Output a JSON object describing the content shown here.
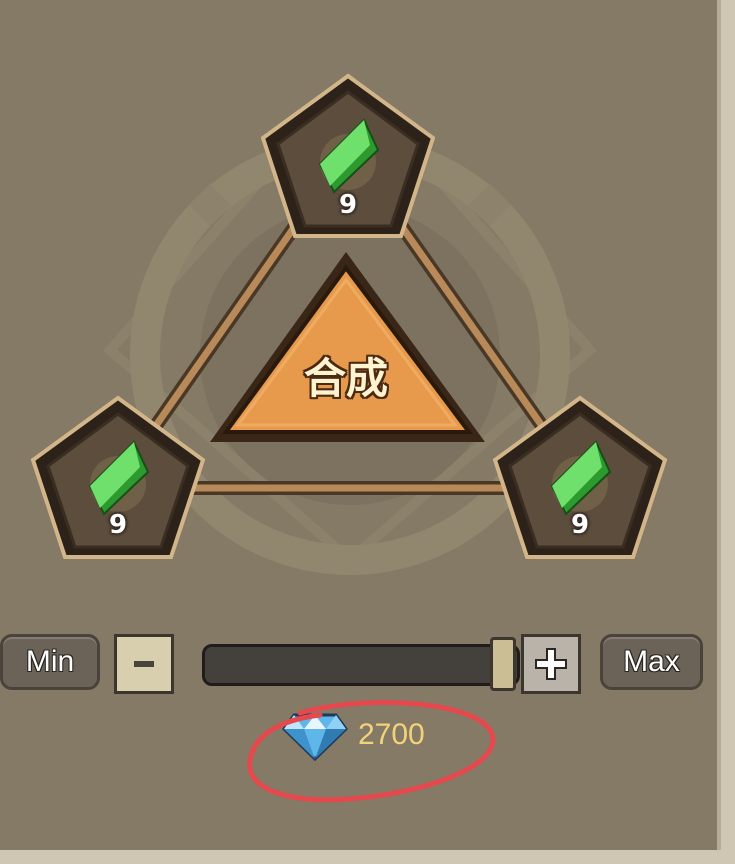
{
  "craft": {
    "button_label": "合成",
    "slots": [
      {
        "position": "top",
        "item_icon": "green-crystal-icon",
        "count": "9"
      },
      {
        "position": "left",
        "item_icon": "green-crystal-icon",
        "count": "9"
      },
      {
        "position": "right",
        "item_icon": "green-crystal-icon",
        "count": "9"
      }
    ]
  },
  "quantity": {
    "min_label": "Min",
    "max_label": "Max",
    "minus_icon": "minus-icon",
    "plus_icon": "plus-icon",
    "slider_fraction": 1.0
  },
  "cost": {
    "currency_icon": "diamond-icon",
    "value": "2700"
  },
  "annotation": {
    "shape": "red-ellipse-around-cost",
    "color": "#e5484d"
  },
  "colors": {
    "background": "#857a66",
    "craft_button": "#e89a4c",
    "cost_text": "#f3d37a",
    "crystal": "#39c53a"
  }
}
